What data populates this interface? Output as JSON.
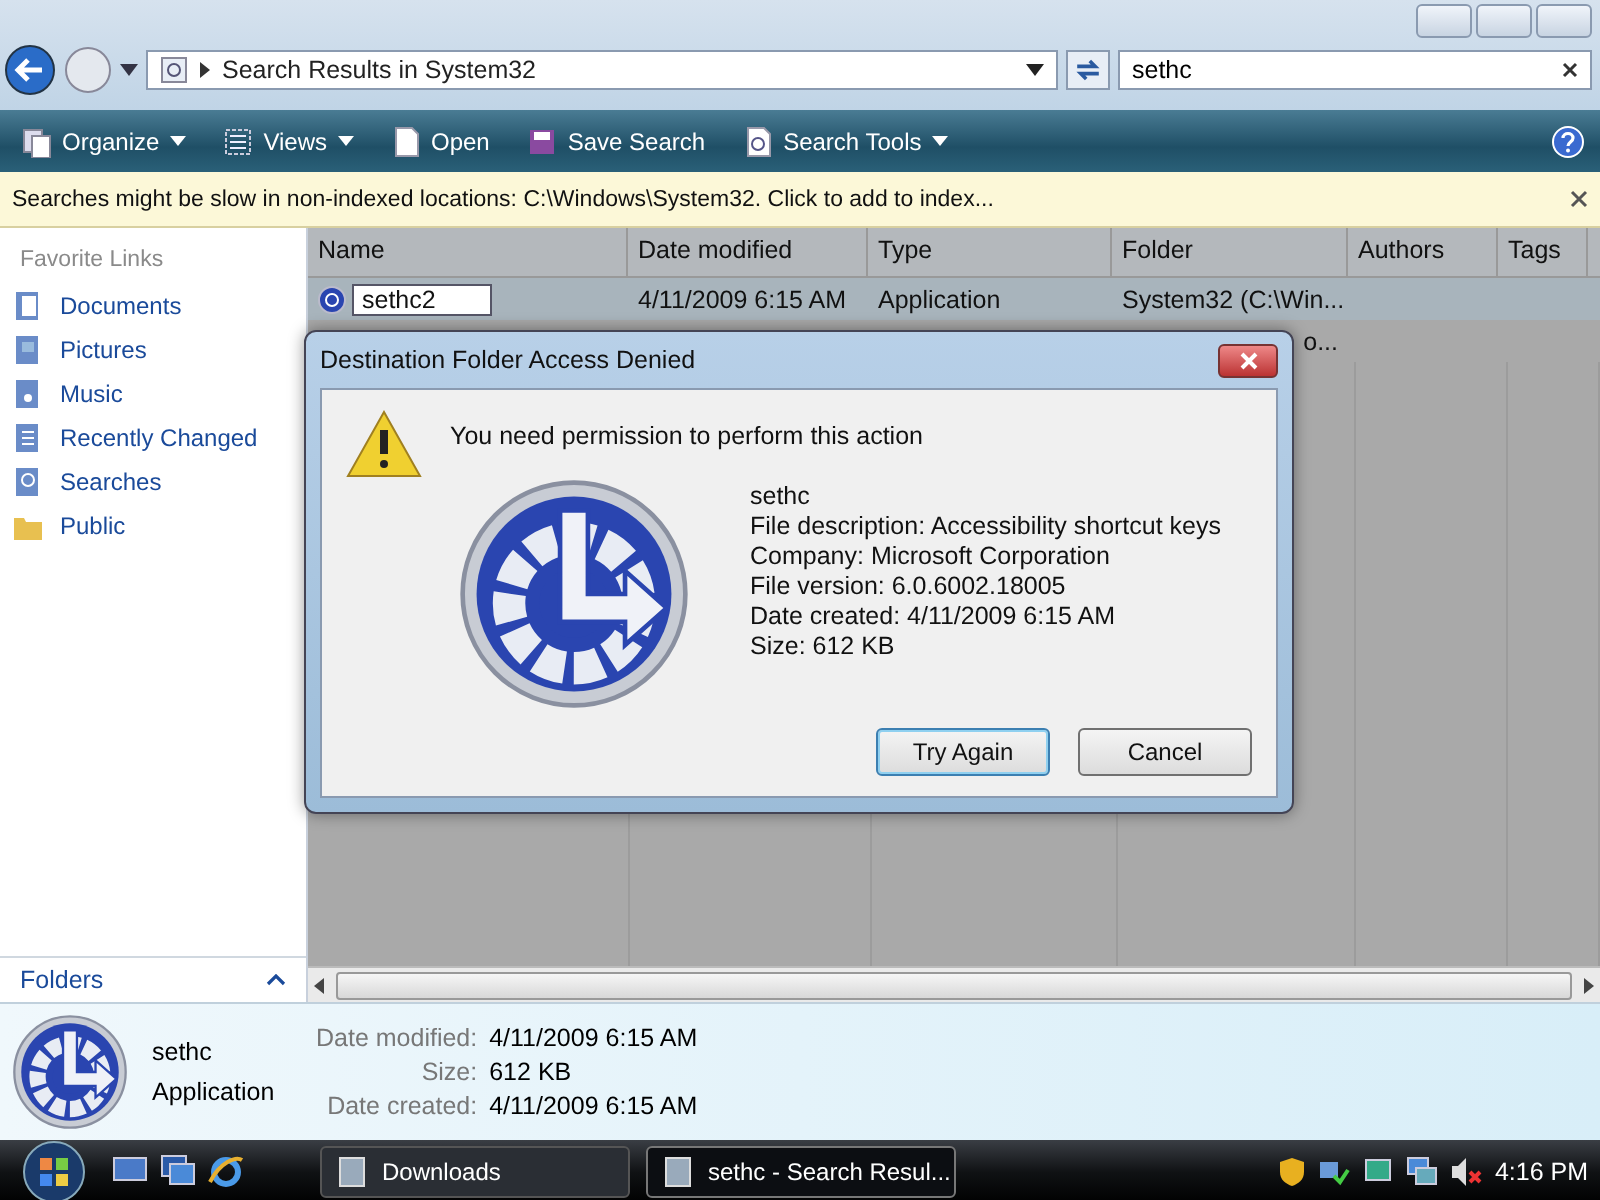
{
  "address": {
    "path": "Search Results in System32"
  },
  "search": {
    "value": "sethc"
  },
  "toolbar": [
    {
      "label": "Organize",
      "kind": "organize",
      "dropdown": true
    },
    {
      "label": "Views",
      "kind": "views",
      "dropdown": true
    },
    {
      "label": "Open",
      "kind": "open",
      "dropdown": false
    },
    {
      "label": "Save Search",
      "kind": "save",
      "dropdown": false
    },
    {
      "label": "Search Tools",
      "kind": "tools",
      "dropdown": true
    }
  ],
  "info_bar": {
    "text": "Searches might be slow in non-indexed locations: C:\\Windows\\System32. Click to add to index..."
  },
  "sidebar": {
    "heading": "Favorite Links",
    "items": [
      {
        "label": "Documents",
        "kind": "documents"
      },
      {
        "label": "Pictures",
        "kind": "pictures"
      },
      {
        "label": "Music",
        "kind": "music"
      },
      {
        "label": "Recently Changed",
        "kind": "recent"
      },
      {
        "label": "Searches",
        "kind": "searches"
      },
      {
        "label": "Public",
        "kind": "public"
      }
    ],
    "folders_label": "Folders"
  },
  "columns": [
    "Name",
    "Date modified",
    "Type",
    "Folder",
    "Authors",
    "Tags"
  ],
  "rows": [
    {
      "name": "sethc2",
      "editing": true,
      "selected": true,
      "date": "4/11/2009 6:15 AM",
      "type": "Application",
      "folder": "System32 (C:\\Win..."
    },
    {
      "name": "",
      "editing": false,
      "selected": false,
      "date": "",
      "type": "",
      "folder": "o..."
    }
  ],
  "dialog": {
    "title": "Destination Folder Access Denied",
    "message": "You need permission to perform this action",
    "file_name": "sethc",
    "details": [
      "File description: Accessibility shortcut keys",
      "Company: Microsoft Corporation",
      "File version: 6.0.6002.18005",
      "Date created: 4/11/2009 6:15 AM",
      "Size: 612 KB"
    ],
    "buttons": [
      {
        "label": "Try Again",
        "default": true
      },
      {
        "label": "Cancel",
        "default": false
      }
    ]
  },
  "details_pane": {
    "name": "sethc",
    "type": "Application",
    "fields": [
      {
        "label": "Date modified:",
        "value": "4/11/2009 6:15 AM"
      },
      {
        "label": "Size:",
        "value": "612 KB"
      },
      {
        "label": "Date created:",
        "value": "4/11/2009 6:15 AM"
      }
    ]
  },
  "taskbar": {
    "tasks": [
      {
        "label": "Downloads",
        "active": false
      },
      {
        "label": "sethc - Search Resul...",
        "active": true
      }
    ],
    "clock": "4:16 PM"
  }
}
